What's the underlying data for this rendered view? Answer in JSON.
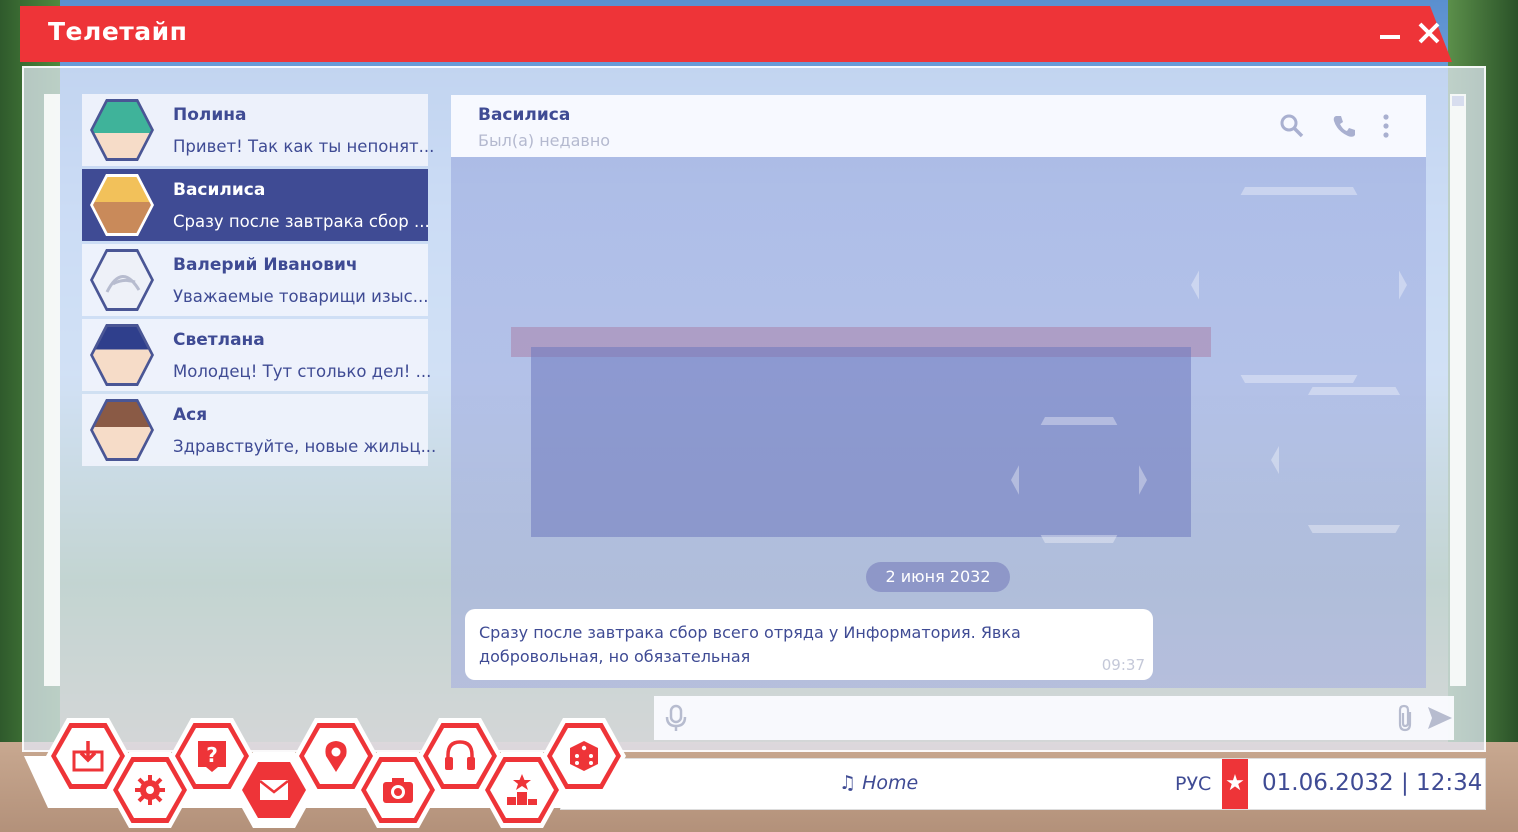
{
  "app": {
    "title": "Телетайп"
  },
  "chats": [
    {
      "name": "Полина",
      "preview": "Привет! Так как ты непонят...",
      "avatar_color": "#3fb39a"
    },
    {
      "name": "Василиса",
      "preview": "Сразу после завтрака сбор ...",
      "avatar_color": "#f2c15a",
      "active": true
    },
    {
      "name": "Валерий Иванович",
      "preview": "Уважаемые товарищи изыс...",
      "avatar_color": "#e9ecf5"
    },
    {
      "name": "Светлана",
      "preview": "Молодец! Тут столько дел! ...",
      "avatar_color": "#2f3f8c"
    },
    {
      "name": "Ася",
      "preview": "Здравствуйте, новые жильц...",
      "avatar_color": "#8a5a45"
    }
  ],
  "conversation": {
    "name": "Василиса",
    "status": "Был(а) недавно",
    "date_separator": "2 июня 2032",
    "messages": [
      {
        "text": "Сразу после завтрака сбор всего отряда у Информатория. Явка добровольная, но обязательная",
        "time": "09:37"
      }
    ]
  },
  "input": {
    "placeholder": ""
  },
  "statusbar": {
    "music": "Home",
    "language": "РУС",
    "datetime": "01.06.2032 | 12:34"
  },
  "dock": [
    "download-icon",
    "settings-icon",
    "help-icon",
    "messages-icon",
    "map-pin-icon",
    "camera-icon",
    "headphones-icon",
    "rating-icon",
    "dice-icon"
  ],
  "colors": {
    "accent": "#ee3438",
    "primary": "#3f4b94"
  }
}
